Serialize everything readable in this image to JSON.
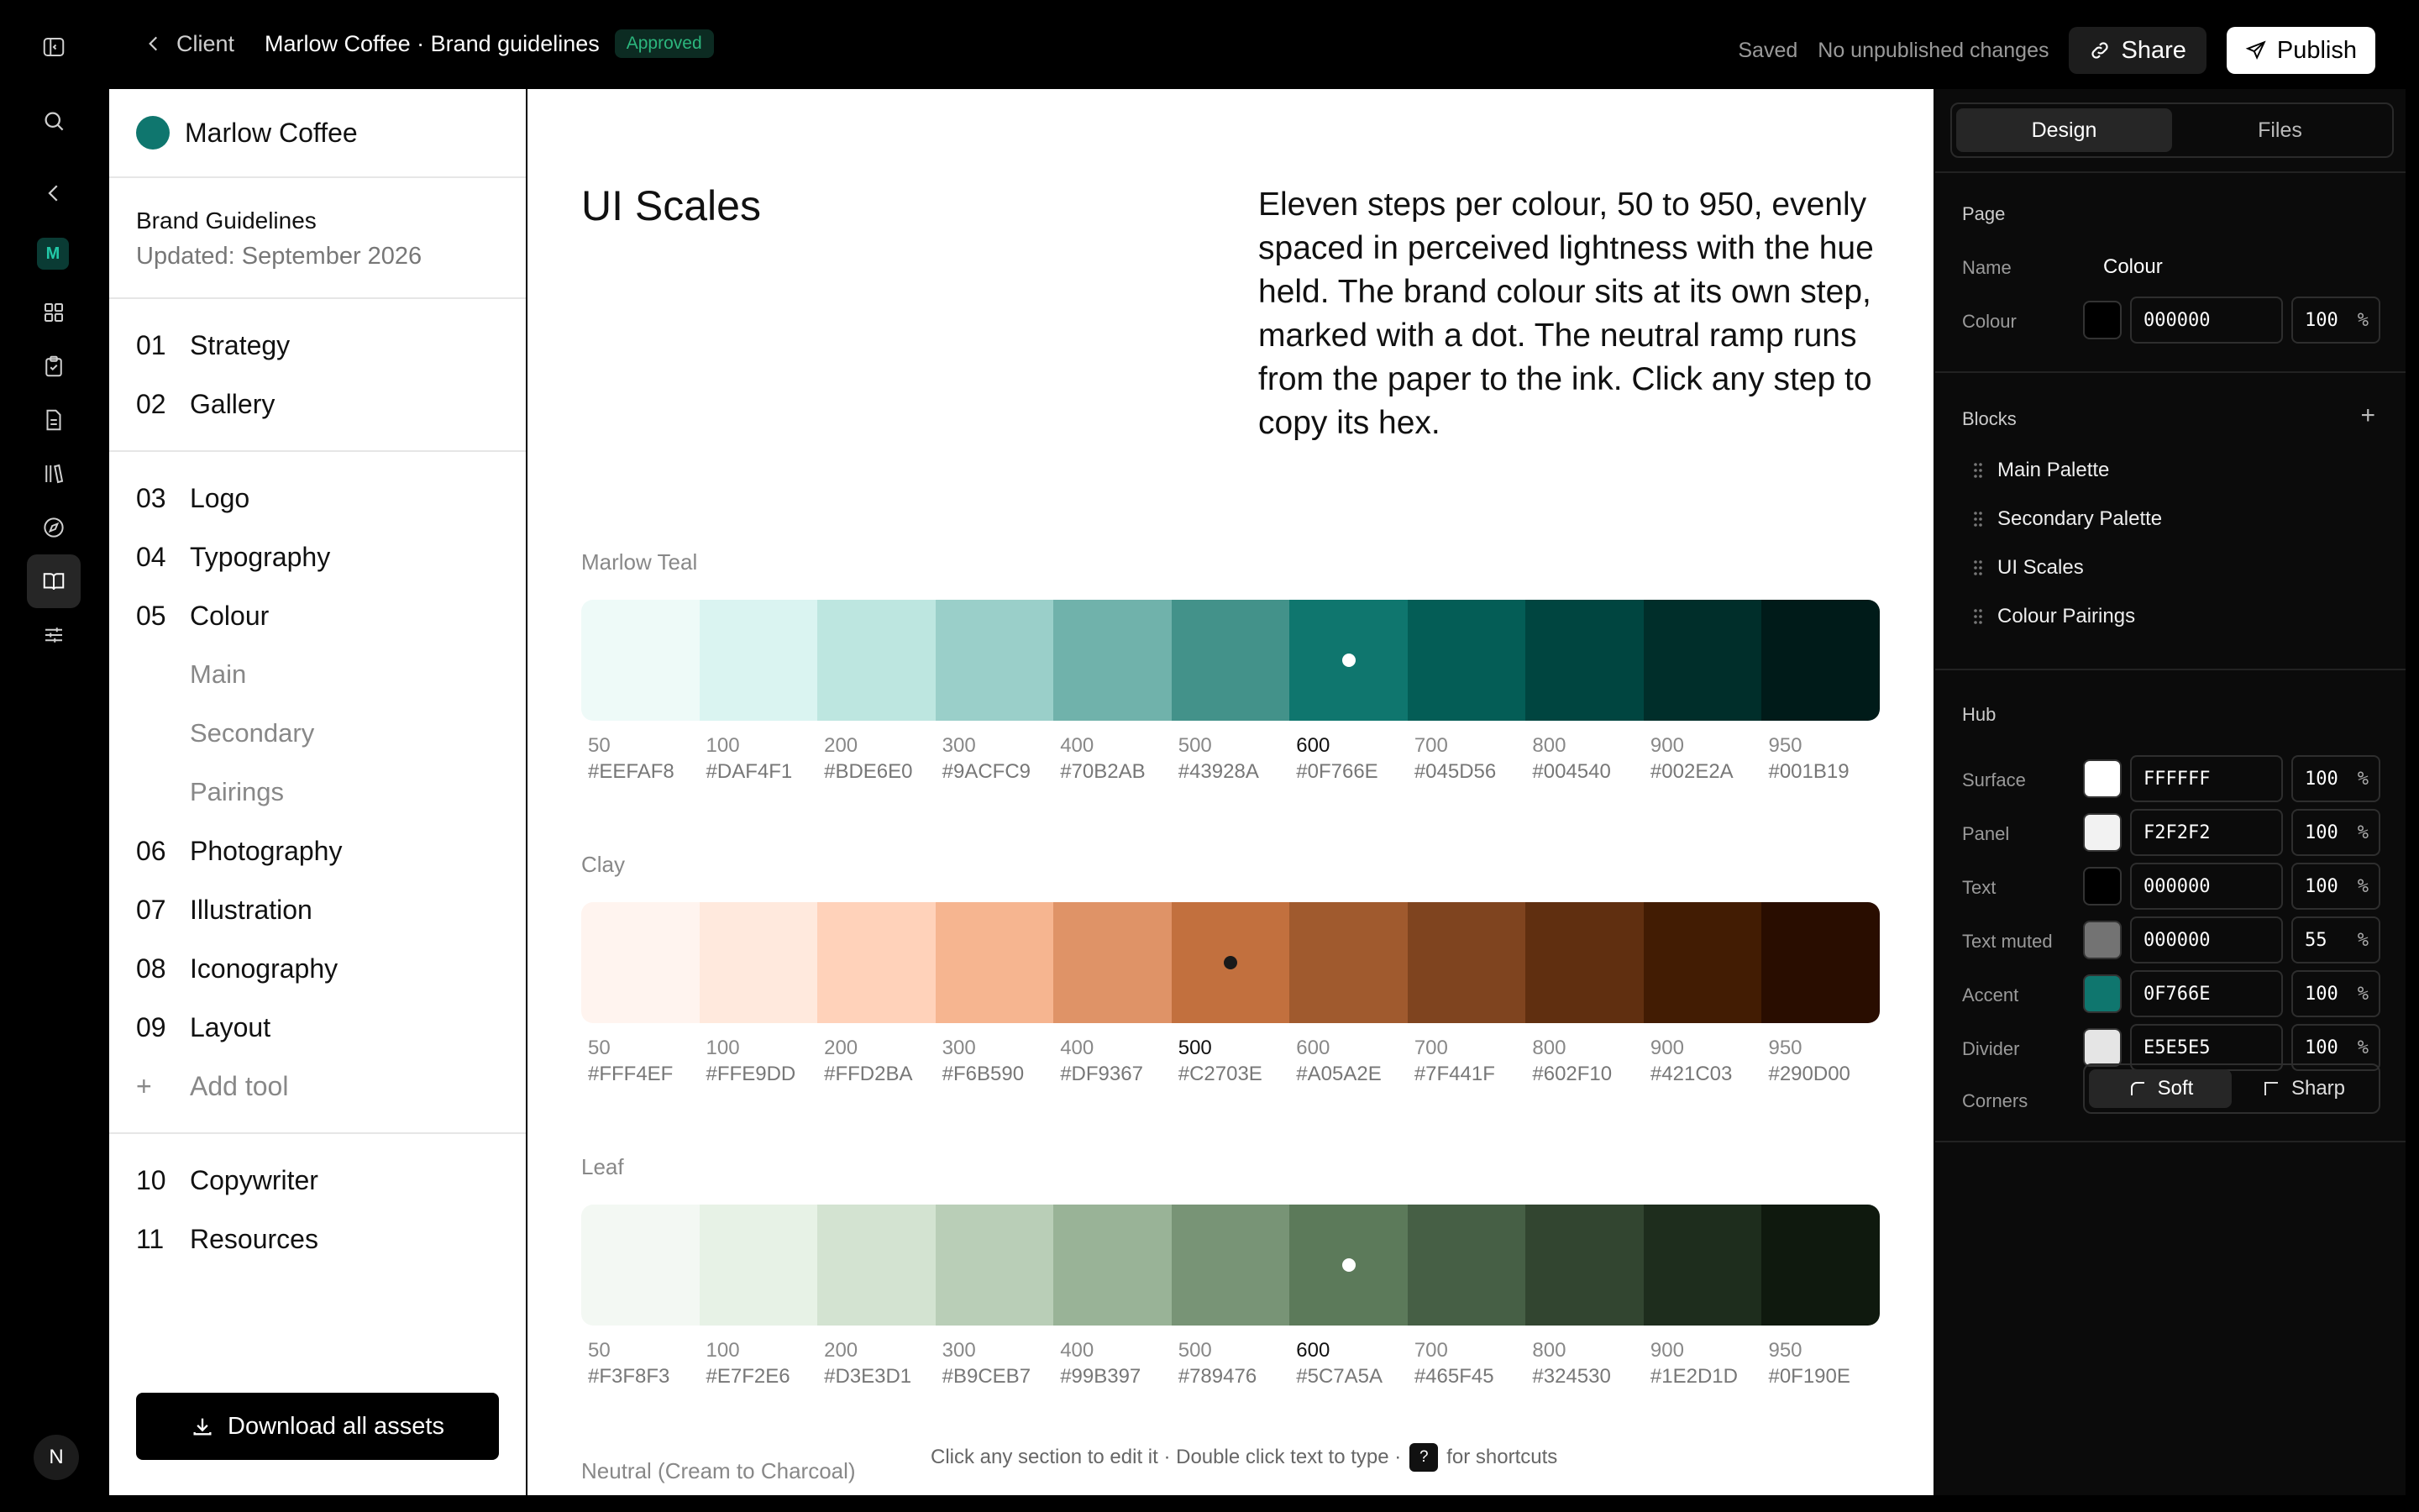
{
  "topbar": {
    "back_label": "Client",
    "title": "Marlow Coffee · Brand guidelines",
    "status_badge": "Approved",
    "saved": "Saved",
    "unpublished": "No unpublished changes",
    "share_label": "Share",
    "publish_label": "Publish"
  },
  "rail": {
    "workspace_badge": "M",
    "user_initial": "N",
    "icons": [
      "sidebar-toggle-icon",
      "search-icon",
      "chevron-left-icon",
      "workspace-badge",
      "grid-icon",
      "clipboard-check-icon",
      "document-icon",
      "library-icon",
      "compass-icon",
      "book-open-icon",
      "sliders-icon"
    ]
  },
  "nav": {
    "brand_name": "Marlow Coffee",
    "brand_color": "#0F766E",
    "meta_title": "Brand Guidelines",
    "meta_updated": "Updated: September 2026",
    "group1": [
      {
        "num": "01",
        "label": "Strategy"
      },
      {
        "num": "02",
        "label": "Gallery"
      }
    ],
    "group2": [
      {
        "num": "03",
        "label": "Logo"
      },
      {
        "num": "04",
        "label": "Typography"
      },
      {
        "num": "05",
        "label": "Colour"
      }
    ],
    "colour_subs": [
      "Main",
      "Secondary",
      "Pairings"
    ],
    "group2b": [
      {
        "num": "06",
        "label": "Photography"
      },
      {
        "num": "07",
        "label": "Illustration"
      },
      {
        "num": "08",
        "label": "Iconography"
      },
      {
        "num": "09",
        "label": "Layout"
      }
    ],
    "add_tool": "Add tool",
    "add_symbol": "+",
    "group3": [
      {
        "num": "10",
        "label": "Copywriter"
      },
      {
        "num": "11",
        "label": "Resources"
      }
    ],
    "download_label": "Download all assets"
  },
  "main": {
    "title": "UI Scales",
    "description": "Eleven steps per colour, 50 to 950, evenly spaced in perceived lightness with the hue held. The brand colour sits at its own step, marked with a dot. The neutral ramp runs from the paper to the ink. Click any step to copy its hex.",
    "hint_before": "Click any section to edit it · Double click text to type ·",
    "hint_key": "?",
    "hint_after": "for shortcuts",
    "neutral_name": "Neutral (Cream to Charcoal)",
    "scales": [
      {
        "name": "Marlow Teal",
        "brand_step": "600",
        "dot_color": "#FFFFFF",
        "steps": [
          {
            "step": "50",
            "hex": "#EEFAF8",
            "color": "#EEFAF8"
          },
          {
            "step": "100",
            "hex": "#DAF4F1",
            "color": "#DAF4F1"
          },
          {
            "step": "200",
            "hex": "#BDE6E0",
            "color": "#BDE6E0"
          },
          {
            "step": "300",
            "hex": "#9ACFC9",
            "color": "#9ACFC9"
          },
          {
            "step": "400",
            "hex": "#70B2AB",
            "color": "#70B2AB"
          },
          {
            "step": "500",
            "hex": "#43928A",
            "color": "#43928A"
          },
          {
            "step": "600",
            "hex": "#0F766E",
            "color": "#0F766E"
          },
          {
            "step": "700",
            "hex": "#045D56",
            "color": "#045D56"
          },
          {
            "step": "800",
            "hex": "#004540",
            "color": "#004540"
          },
          {
            "step": "900",
            "hex": "#002E2A",
            "color": "#002E2A"
          },
          {
            "step": "950",
            "hex": "#001B19",
            "color": "#001B19"
          }
        ]
      },
      {
        "name": "Clay",
        "brand_step": "500",
        "dot_color": "#1A1A1A",
        "steps": [
          {
            "step": "50",
            "hex": "#FFF4EF",
            "color": "#FFF4EF"
          },
          {
            "step": "100",
            "hex": "#FFE9DD",
            "color": "#FFE9DD"
          },
          {
            "step": "200",
            "hex": "#FFD2BA",
            "color": "#FFD2BA"
          },
          {
            "step": "300",
            "hex": "#F6B590",
            "color": "#F6B590"
          },
          {
            "step": "400",
            "hex": "#DF9367",
            "color": "#DF9367"
          },
          {
            "step": "500",
            "hex": "#C2703E",
            "color": "#C2703E"
          },
          {
            "step": "600",
            "hex": "#A05A2E",
            "color": "#A05A2E"
          },
          {
            "step": "700",
            "hex": "#7F441F",
            "color": "#7F441F"
          },
          {
            "step": "800",
            "hex": "#602F10",
            "color": "#602F10"
          },
          {
            "step": "900",
            "hex": "#421C03",
            "color": "#421C03"
          },
          {
            "step": "950",
            "hex": "#290D00",
            "color": "#290D00"
          }
        ]
      },
      {
        "name": "Leaf",
        "brand_step": "600",
        "dot_color": "#FFFFFF",
        "steps": [
          {
            "step": "50",
            "hex": "#F3F8F3",
            "color": "#F3F8F3"
          },
          {
            "step": "100",
            "hex": "#E7F2E6",
            "color": "#E7F2E6"
          },
          {
            "step": "200",
            "hex": "#D3E3D1",
            "color": "#D3E3D1"
          },
          {
            "step": "300",
            "hex": "#B9CEB7",
            "color": "#B9CEB7"
          },
          {
            "step": "400",
            "hex": "#99B397",
            "color": "#99B397"
          },
          {
            "step": "500",
            "hex": "#789476",
            "color": "#789476"
          },
          {
            "step": "600",
            "hex": "#5C7A5A",
            "color": "#5C7A5A"
          },
          {
            "step": "700",
            "hex": "#465F45",
            "color": "#465F45"
          },
          {
            "step": "800",
            "hex": "#324530",
            "color": "#324530"
          },
          {
            "step": "900",
            "hex": "#1E2D1D",
            "color": "#1E2D1D"
          },
          {
            "step": "950",
            "hex": "#0F190E",
            "color": "#0F190E"
          }
        ]
      }
    ]
  },
  "panel": {
    "tabs": [
      "Design",
      "Files"
    ],
    "active_tab": "Design",
    "page_section": "Page",
    "name_label": "Name",
    "name_value": "Colour",
    "colour_label": "Colour",
    "colour_hex": "000000",
    "colour_pct": "100",
    "colour_swatch": "#000000",
    "blocks_section": "Blocks",
    "add_block": "+",
    "blocks": [
      "Main Palette",
      "Secondary Palette",
      "UI Scales",
      "Colour Pairings"
    ],
    "hub_section": "Hub",
    "pct_unit": "%",
    "hub": [
      {
        "label": "Surface",
        "hex": "FFFFFF",
        "pct": "100",
        "swatch": "#FFFFFF"
      },
      {
        "label": "Panel",
        "hex": "F2F2F2",
        "pct": "100",
        "swatch": "#F2F2F2"
      },
      {
        "label": "Text",
        "hex": "000000",
        "pct": "100",
        "swatch": "#000000"
      },
      {
        "label": "Text muted",
        "hex": "000000",
        "pct": "55",
        "swatch": "#737373"
      },
      {
        "label": "Accent",
        "hex": "0F766E",
        "pct": "100",
        "swatch": "#0F766E"
      },
      {
        "label": "Divider",
        "hex": "E5E5E5",
        "pct": "100",
        "swatch": "#E5E5E5"
      }
    ],
    "corners_label": "Corners",
    "corners_options": [
      "Soft",
      "Sharp"
    ],
    "corners_active": "Soft"
  }
}
